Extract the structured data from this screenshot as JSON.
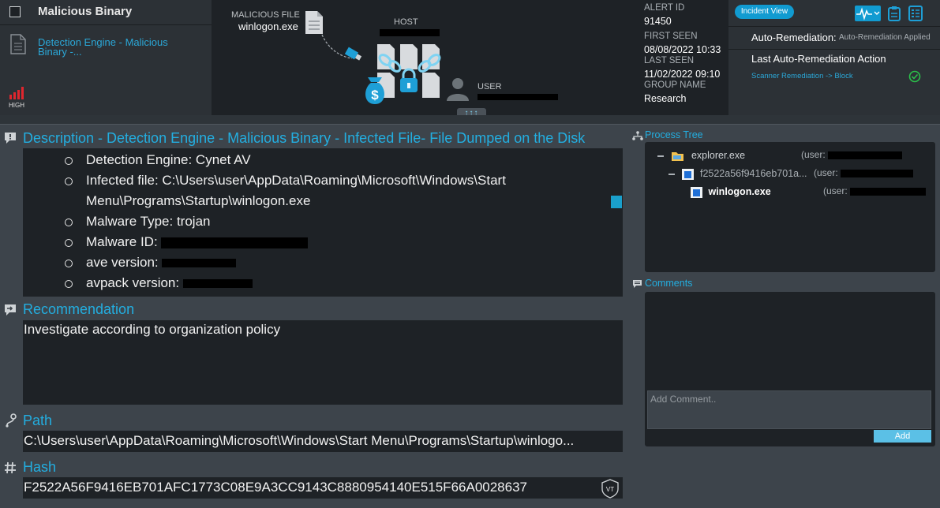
{
  "alert": {
    "title": "Malicious Binary",
    "detection_link": "Detection Engine - Malicious Binary -...",
    "severity": "HIGH"
  },
  "graph": {
    "malicious_file_label": "MALICIOUS FILE",
    "malicious_file_name": "winlogon.exe",
    "host_label": "HOST",
    "user_label": "USER",
    "expand_label": "↑↑↑"
  },
  "meta": {
    "alert_id_label": "ALERT ID",
    "alert_id": "91450",
    "first_seen_label": "FIRST SEEN",
    "first_seen": "08/08/2022 10:33",
    "last_seen_label": "LAST SEEN",
    "last_seen": "11/02/2022 09:10",
    "group_name_label": "GROUP NAME",
    "group_name": "Research"
  },
  "remediation": {
    "incident_view": "Incident View",
    "auto_label": "Auto-Remediation:",
    "auto_status": "Auto-Remediation Applied",
    "last_action_title": "Last Auto-Remediation Action",
    "last_action_link": "Scanner Remediation -> Block"
  },
  "description": {
    "title": "Description - Detection Engine - Malicious Binary - Infected File- File Dumped on the Disk",
    "items": [
      "Detection Engine: Cynet AV",
      "Infected file: C:\\Users\\user\\AppData\\Roaming\\Microsoft\\Windows\\Start Menu\\Programs\\Startup\\winlogon.exe",
      "Malware Type: trojan",
      "Malware ID:",
      "ave version:",
      "avpack version:"
    ]
  },
  "recommendation": {
    "title": "Recommendation",
    "text": "Investigate according to organization policy"
  },
  "path": {
    "title": "Path",
    "value": "C:\\Users\\user\\AppData\\Roaming\\Microsoft\\Windows\\Start Menu\\Programs\\Startup\\winlogo..."
  },
  "hash": {
    "title": "Hash",
    "value": "F2522A56F9416EB701AFC1773C08E9A3CC9143C8880954140E515F66A0028637",
    "badge": "VT"
  },
  "process_tree": {
    "title": "Process Tree",
    "nodes": [
      {
        "name": "explorer.exe",
        "user": "(user:"
      },
      {
        "name": "f2522a56f9416eb701a...",
        "user": "(user:"
      },
      {
        "name": "winlogon.exe",
        "user": "(user:"
      }
    ]
  },
  "comments": {
    "title": "Comments",
    "placeholder": "Add Comment..",
    "add_label": "Add"
  },
  "colors": {
    "accent": "#23aee0",
    "link": "#2ba8d8",
    "severity_high": "#e0262e",
    "success": "#2bbf4a"
  },
  "icons": [
    "document-icon",
    "severity-bars-icon",
    "file-icon",
    "usb-icon",
    "host-files-icon",
    "lock-icon",
    "money-bag-icon",
    "user-icon",
    "activity-icon",
    "clipboard-icon",
    "list-icon",
    "check-circle-icon",
    "comment-icon",
    "tree-icon",
    "path-icon",
    "hash-icon",
    "folder-icon",
    "exe-icon",
    "vt-badge"
  ]
}
